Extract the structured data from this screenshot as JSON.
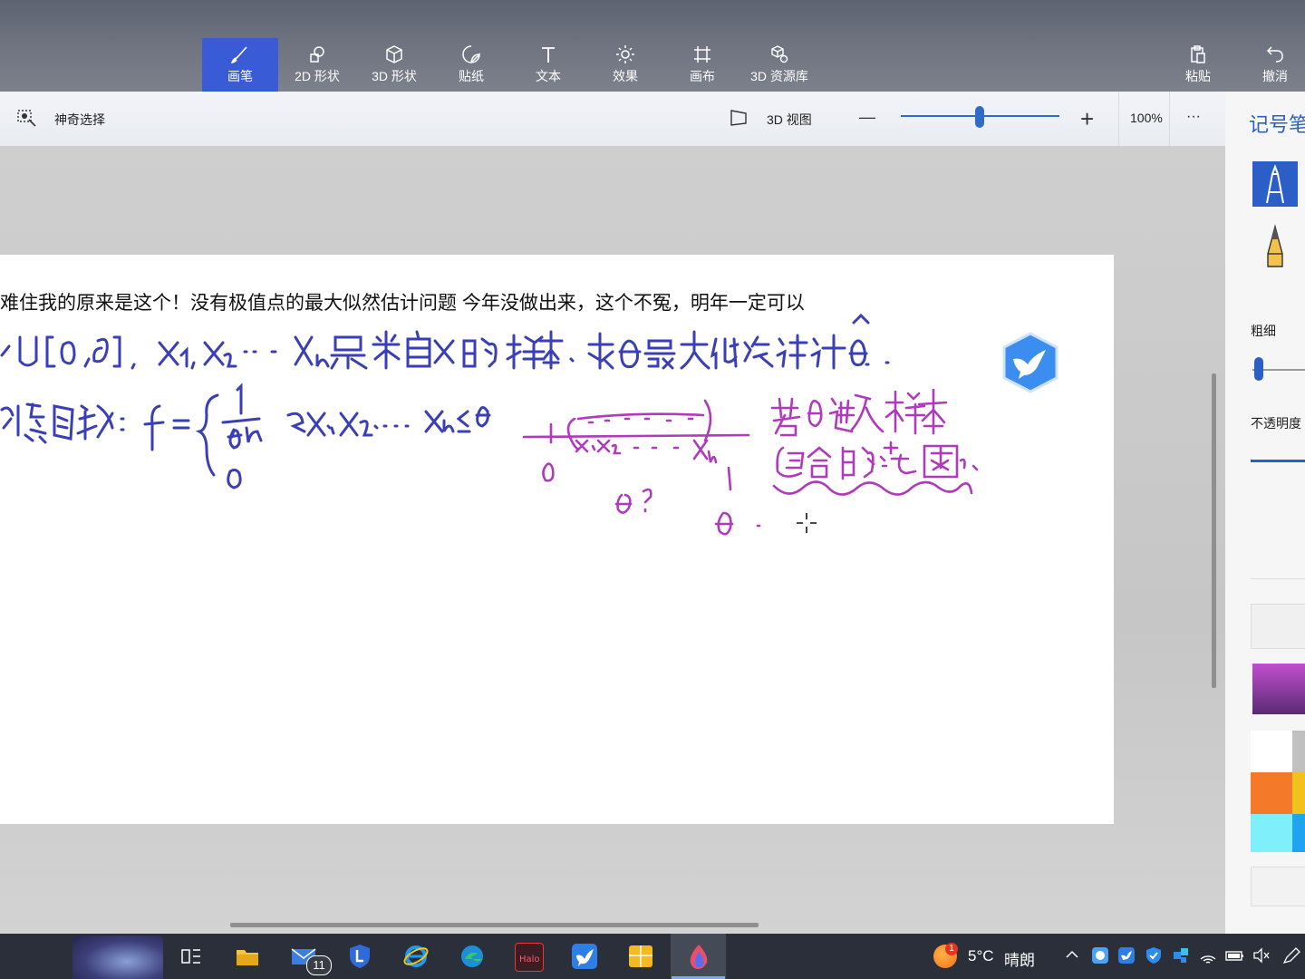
{
  "ribbon": {
    "tabs": [
      {
        "label": "画笔",
        "icon": "brush-icon"
      },
      {
        "label": "2D 形状",
        "icon": "2d-shapes-icon"
      },
      {
        "label": "3D 形状",
        "icon": "3d-shapes-icon"
      },
      {
        "label": "贴纸",
        "icon": "sticker-icon"
      },
      {
        "label": "文本",
        "icon": "text-icon"
      },
      {
        "label": "效果",
        "icon": "effects-icon"
      },
      {
        "label": "画布",
        "icon": "canvas-icon"
      },
      {
        "label": "3D 资源库",
        "icon": "3d-library-icon"
      }
    ],
    "paste_label": "粘贴",
    "undo_label": "撤消",
    "active_color": "#3a5bd6"
  },
  "subbar": {
    "magic_select_label": "神奇选择",
    "view3d_label": "3D 视图",
    "zoom_value": "100%",
    "zoom_fraction": 0.5,
    "minus": "—",
    "plus": "+",
    "more": "···"
  },
  "panel": {
    "title": "记号笔",
    "thickness_label": "粗细",
    "opacity_label": "不透明度",
    "thickness_fraction": 0.05,
    "swatches": [
      "#ffffff",
      "#c0c0c0",
      "#f47a2a",
      "#f3c21a",
      "#7ff0fb",
      "#1fa4f0"
    ],
    "current_color": "#b53ebf"
  },
  "canvas": {
    "typed_text": "难住我的原来是这个！没有极值点的最大似然估计问题 今年没做出来，这个不冤，明年一定可以",
    "ink_blue": "#3a3fb6",
    "ink_purple": "#b03abc"
  },
  "taskbar": {
    "weather_temp": "5°C",
    "weather_desc": "晴朗",
    "mail_badge": "11",
    "weather_badge": "1"
  }
}
